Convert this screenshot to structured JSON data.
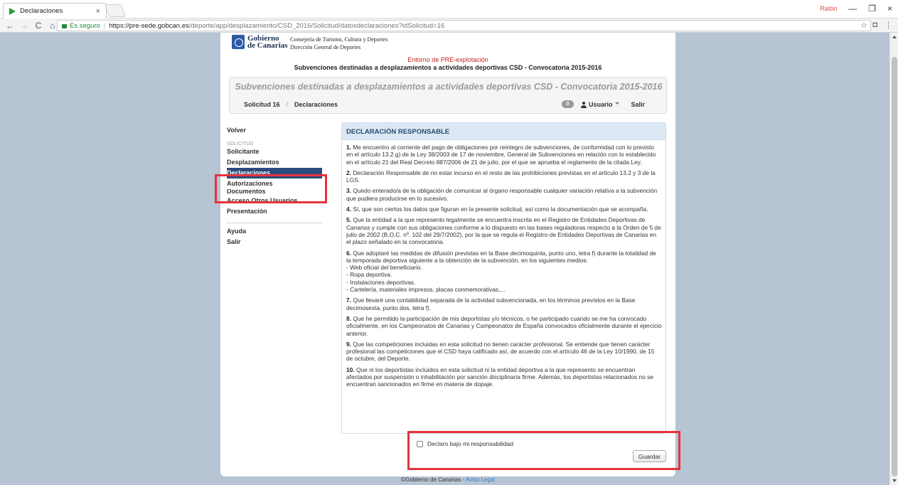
{
  "browser": {
    "tab_title": "Declaraciones",
    "tab_close": "×",
    "profile_label": "Ratón",
    "url_secure_label": "Es seguro",
    "url_separator": "|",
    "url_host": "https://pre-sede.gobcan.es",
    "url_path": "/deporte/app/desplazamiento/CSD_2016/Solicitud/datosdeclaraciones?idSolicitud=16",
    "nav_back": "←",
    "nav_forward": "→",
    "nav_reload": "C",
    "nav_home": "⌂",
    "star": "☆",
    "ext_icon": "◘",
    "menu_icon": "⋮",
    "win_minimize": "—",
    "win_restore": "❐",
    "win_close": "×"
  },
  "header": {
    "logo_line1": "Gobierno",
    "logo_line2": "de Canarias",
    "consejeria": "Consejería de Turismo, Cultura y Deportes",
    "direccion": "Dirección General de Deportes",
    "environment": "Entorno de PRE-explotación",
    "subtitle": "Subvenciones destinadas a desplazamientos a actividades deportivas CSD - Convocatoria 2015-2016"
  },
  "hero": {
    "title": "Subvenciones destinadas a desplazamientos a actividades deportivas CSD - Convocatoria 2015-2016",
    "crumb_solicitud": "Solicitud 16",
    "crumb_sep": "/",
    "crumb_current": "Declaraciones",
    "badge_count": "0",
    "user_label": "Usuario",
    "logout_label": "Salir"
  },
  "sidebar": {
    "back": "Volver",
    "section": "SOLICITUD",
    "items": [
      "Solicitante",
      "Desplazamientos",
      "Declaraciones",
      "Autorizaciones",
      "Documentos",
      "Acceso Otros Usuarios",
      "Presentación"
    ],
    "help": "Ayuda",
    "exit": "Salir"
  },
  "panel": {
    "title": "DECLARACIÓN RESPONSABLE",
    "items": [
      {
        "num": "1.",
        "text": " Me encuentro al corriente del pago de obligaciones por reintegro de subvenciones, de conformidad con lo previsto en el artículo 13.2.g) de la Ley 38/2003 de 17 de noviembre, General de Subvenciones en relación con lo establecido en el artículo 21 del Real Decreto 887/2006 de 21 de julio, por el que se aprueba el reglamento de la citada Ley."
      },
      {
        "num": "2.",
        "text": " Declaración Responsable de no estar incurso en el resto de las prohibiciones previstas en el artículo 13.2 y 3 de la LGS."
      },
      {
        "num": "3.",
        "text": " Quedo enterado/a de la obligación de comunicar al órgano responsable cualquier variación relativa a la subvención que pudiera producirse en lo sucesivo."
      },
      {
        "num": "4.",
        "text": " Sí, que son ciertos los datos que figuran en la presente solicitud, así como la documentación que se acompaña."
      },
      {
        "num": "5.",
        "text": " Que la entidad a la que represento legalmente se encuentra inscrita en el Registro de Entidades Deportivas de Canarias y cumple con sus obligaciones conforme a lo dispuesto en las bases reguladoras respecto a la Orden de 5 de julio de 2002 (B.O.C. nº. 102 del 29/7/2002), por la que se regula el Registro de Entidades Deportivas de Canarias en el plazo señalado en la convocatoria."
      },
      {
        "num": "6.",
        "text": " Que adoptaré las medidas de difusión previstas en la Base decimoquinta, punto uno, letra f) durante la totalidad de la temporada deportiva siguiente a la obtención de la subvención, en los siguientes medios:"
      },
      {
        "num": "7.",
        "text": " Que llevaré una contabilidad separada de la actividad subvencionada, en los términos previstos en la Base decimosexta, punto dos, letra f)."
      },
      {
        "num": "8.",
        "text": " Que he permitido la participación de mis deportistas y/o técnicos, o he participado cuando se me ha convocado oficialmente, en los Campeonatos de Canarias y Campeonatos de España convocados oficialmente durante el ejercicio anterior."
      },
      {
        "num": "9.",
        "text": " Que las competiciones incluidas en esta solicitud no tienen carácter profesional. Se entiende que tienen carácter profesional las competiciones que el CSD haya calificado así, de acuerdo con el artículo 46 de la Ley 10/1990, de 15 de octubre, del Deporte."
      },
      {
        "num": "10.",
        "text": " Que ni los deportistas incluidos en esta solicitud ni la entidad deportiva a la que represento se encuentran afectados por suspensión o inhabilitación por sanción disciplinaria firme. Además, los deportistas relacionados no se encuentran sancionados en firme en materia de dopaje."
      }
    ],
    "item6_list": [
      "- Web oficial del beneficiario.",
      "- Ropa deportiva.",
      "- Instalaciones deportivas.",
      "- Cartelería, materiales impresos, placas conmemorativas,..."
    ]
  },
  "form": {
    "declare_label": "Declaro bajo mi responsabilidad",
    "save_label": "Guardar"
  },
  "footer": {
    "copyright": "©Gobierno de Canarias - ",
    "legal_link": "Aviso Legal"
  },
  "colors": {
    "highlight": "#e5333a",
    "active_nav": "#2c4a7d",
    "panel_header": "#dbe8f4",
    "background": "#b6c4d3"
  }
}
